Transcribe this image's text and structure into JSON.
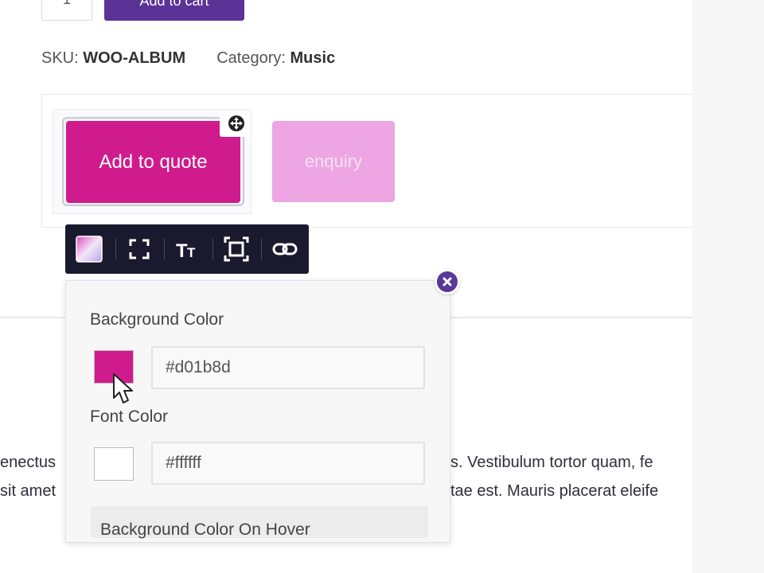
{
  "cart": {
    "qty_value": "1",
    "add_to_cart_label": "Add to cart"
  },
  "meta": {
    "sku_label": "SKU:",
    "sku_value": "WOO-ALBUM",
    "category_label": "Category:",
    "category_value": "Music"
  },
  "quote_buttons": {
    "add_to_quote_label": "Add to quote",
    "enquiry_label": "enquiry"
  },
  "toolbar": {
    "items": [
      {
        "icon": "gradient-color-icon"
      },
      {
        "icon": "fullscreen-icon"
      },
      {
        "icon": "typography-icon"
      },
      {
        "icon": "padding-frame-icon"
      },
      {
        "icon": "link-icon"
      }
    ]
  },
  "style_panel": {
    "background_color_label": "Background Color",
    "background_color_value": "#d01b8d",
    "font_color_label": "Font Color",
    "font_color_value": "#ffffff",
    "background_hover_label": "Background Color On Hover"
  },
  "body_text": {
    "left_line1": "enectus",
    "left_line2": "sit amet",
    "right_line1": "s. Vestibulum tortor quam, fe",
    "right_line2": "tae est. Mauris placerat eleife"
  },
  "colors": {
    "accent_purple": "#5b3296",
    "quote_pink": "#d01b8d",
    "enquiry_pink": "#eda6e3",
    "toolbar_dark": "#1a1a2e"
  }
}
